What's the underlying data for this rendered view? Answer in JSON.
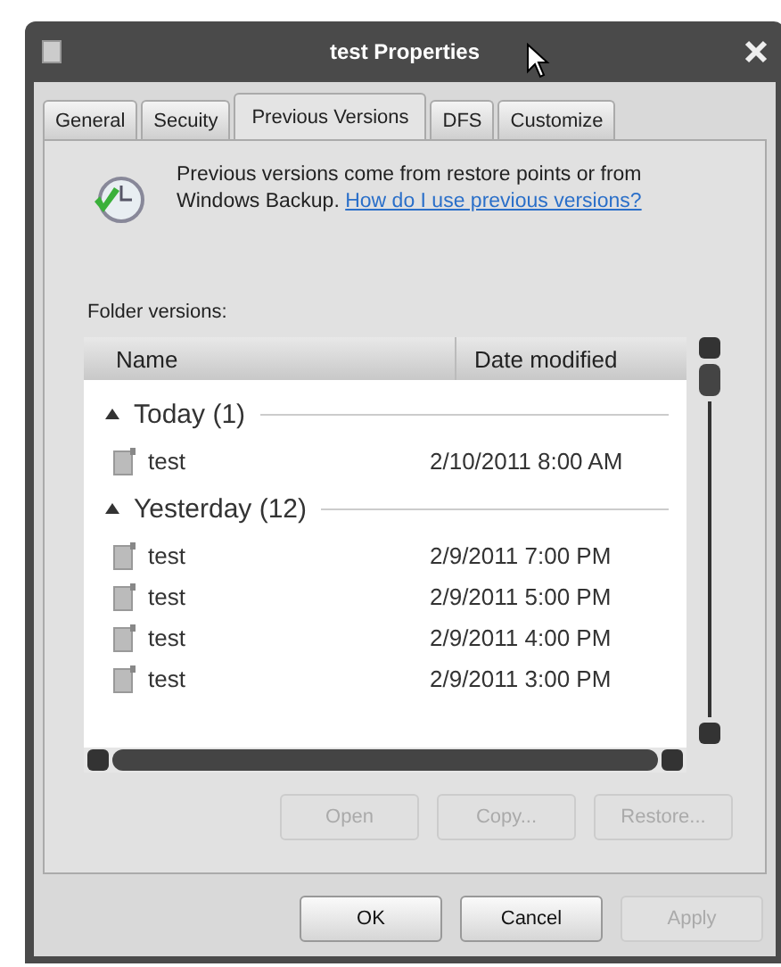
{
  "window": {
    "title": "test Properties"
  },
  "tabs": [
    {
      "label": "General",
      "selected": false
    },
    {
      "label": "Secuity",
      "selected": false
    },
    {
      "label": "Previous Versions",
      "selected": true
    },
    {
      "label": "DFS",
      "selected": false
    },
    {
      "label": "Customize",
      "selected": false
    }
  ],
  "info": {
    "text": "Previous versions come from restore points or from Windows Backup.",
    "link": "How do I use previous versions?"
  },
  "list_label": "Folder versions:",
  "columns": [
    "Name",
    "Date modified"
  ],
  "groups": [
    {
      "title": "Today (1)",
      "expanded": true,
      "items": [
        {
          "name": "test",
          "date": "2/10/2011 8:00 AM"
        }
      ]
    },
    {
      "title": "Yesterday (12)",
      "expanded": true,
      "items": [
        {
          "name": "test",
          "date": "2/9/2011 7:00 PM"
        },
        {
          "name": "test",
          "date": "2/9/2011 5:00 PM"
        },
        {
          "name": "test",
          "date": "2/9/2011 4:00 PM"
        },
        {
          "name": "test",
          "date": "2/9/2011 3:00 PM"
        }
      ]
    }
  ],
  "actions": [
    {
      "label": "Open",
      "disabled": true
    },
    {
      "label": "Copy...",
      "disabled": true
    },
    {
      "label": "Restore...",
      "disabled": true
    }
  ],
  "buttons": [
    {
      "label": "OK",
      "disabled": false
    },
    {
      "label": "Cancel",
      "disabled": false
    },
    {
      "label": "Apply",
      "disabled": true
    }
  ]
}
